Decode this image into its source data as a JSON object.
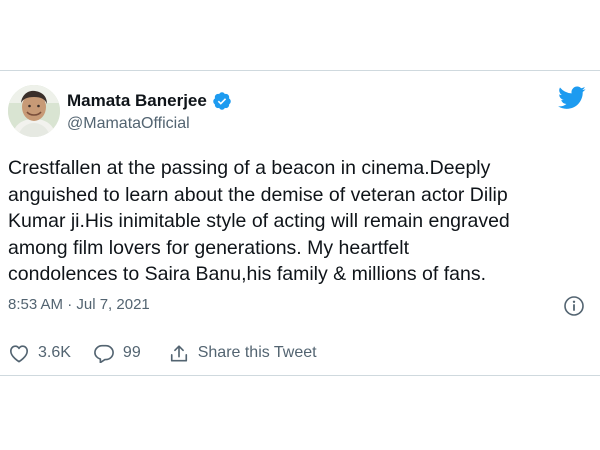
{
  "tweet": {
    "author": {
      "display_name": "Mamata Banerjee",
      "handle": "@MamataOfficial",
      "verified": true
    },
    "text": "Crestfallen at the passing of a beacon in cinema.Deeply\nanguished to learn about the demise of veteran actor Dilip\nKumar ji.His inimitable style of acting will remain engraved\namong film lovers for generations. My heartfelt\ncondolences to Saira Banu,his family & millions of fans.",
    "timestamp": "8:53 AM · Jul 7, 2021",
    "actions": {
      "likes": "3.6K",
      "replies": "99",
      "share_label": "Share this Tweet"
    }
  },
  "icons": {
    "brand": "twitter-bird-icon",
    "verified": "verified-badge-icon",
    "info": "info-icon",
    "like": "heart-icon",
    "reply": "reply-icon",
    "share": "share-icon"
  },
  "colors": {
    "brand_blue": "#1d9bf0",
    "text_primary": "#0f1419",
    "text_secondary": "#536471",
    "border": "#cfd9de"
  }
}
